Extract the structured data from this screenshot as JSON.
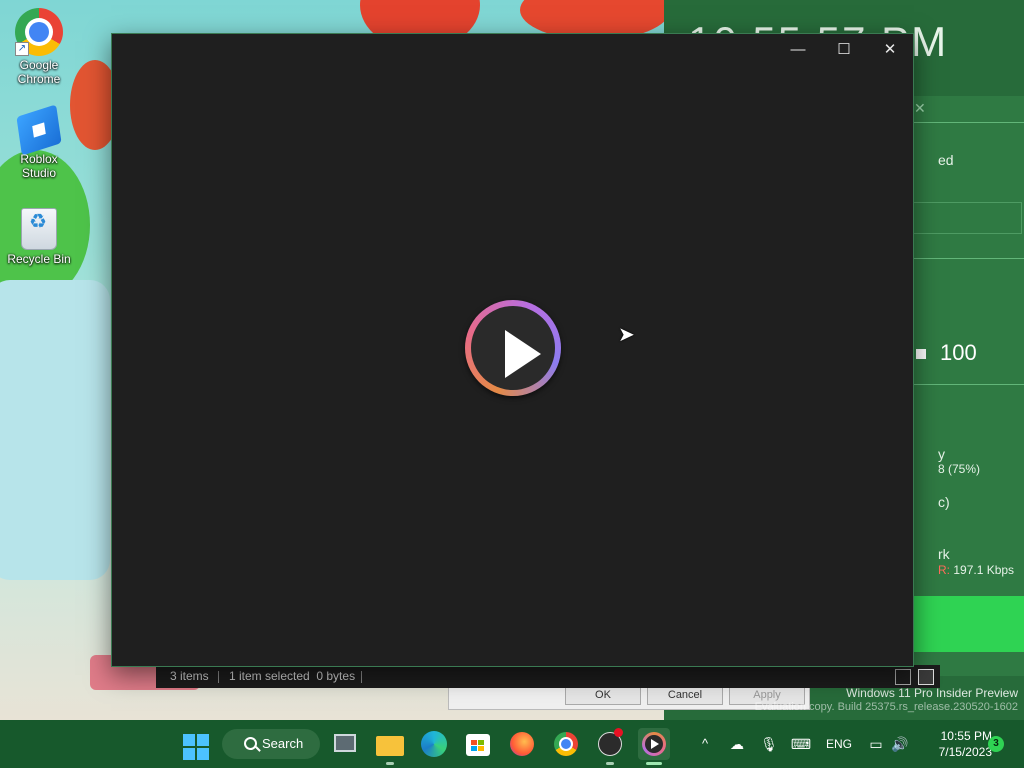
{
  "desktop": {
    "icons": [
      {
        "label_line1": "Google",
        "label_line2": "Chrome",
        "icon": "chrome-icon"
      },
      {
        "label_line1": "Roblox Studio",
        "label_line2": "",
        "icon": "roblox-studio-icon"
      },
      {
        "label_line1": "Recycle Bin",
        "label_line2": "",
        "icon": "recycle-bin-icon"
      }
    ]
  },
  "background_app": {
    "clock_text": "10:55:57 PM",
    "partial_status": "ed",
    "value": "100",
    "memory_label": "y",
    "memory_value": "8 (75%)",
    "disk_label": "c)",
    "network_label": "rk",
    "network_prefix": "R:",
    "network_value": "197.1 Kbps",
    "accent": "#2fd353"
  },
  "dialog_behind": {
    "ok": "OK",
    "cancel": "Cancel",
    "apply": "Apply"
  },
  "main_window": {
    "minimize_symbol": "—",
    "maximize_symbol": "☐",
    "close_symbol": "✕",
    "play_icon": "play-icon"
  },
  "statusbar": {
    "items": "3 items",
    "selection": "1 item selected  0 bytes"
  },
  "watermark": {
    "line1": "Windows 11 Pro Insider Preview",
    "line2": "Evaluation copy. Build 25375.rs_release.230520-1602"
  },
  "taskbar": {
    "search_label": "Search",
    "language": "ENG",
    "time": "10:55 PM",
    "date": "7/15/2023",
    "notifications": "3",
    "chevron": "^"
  }
}
